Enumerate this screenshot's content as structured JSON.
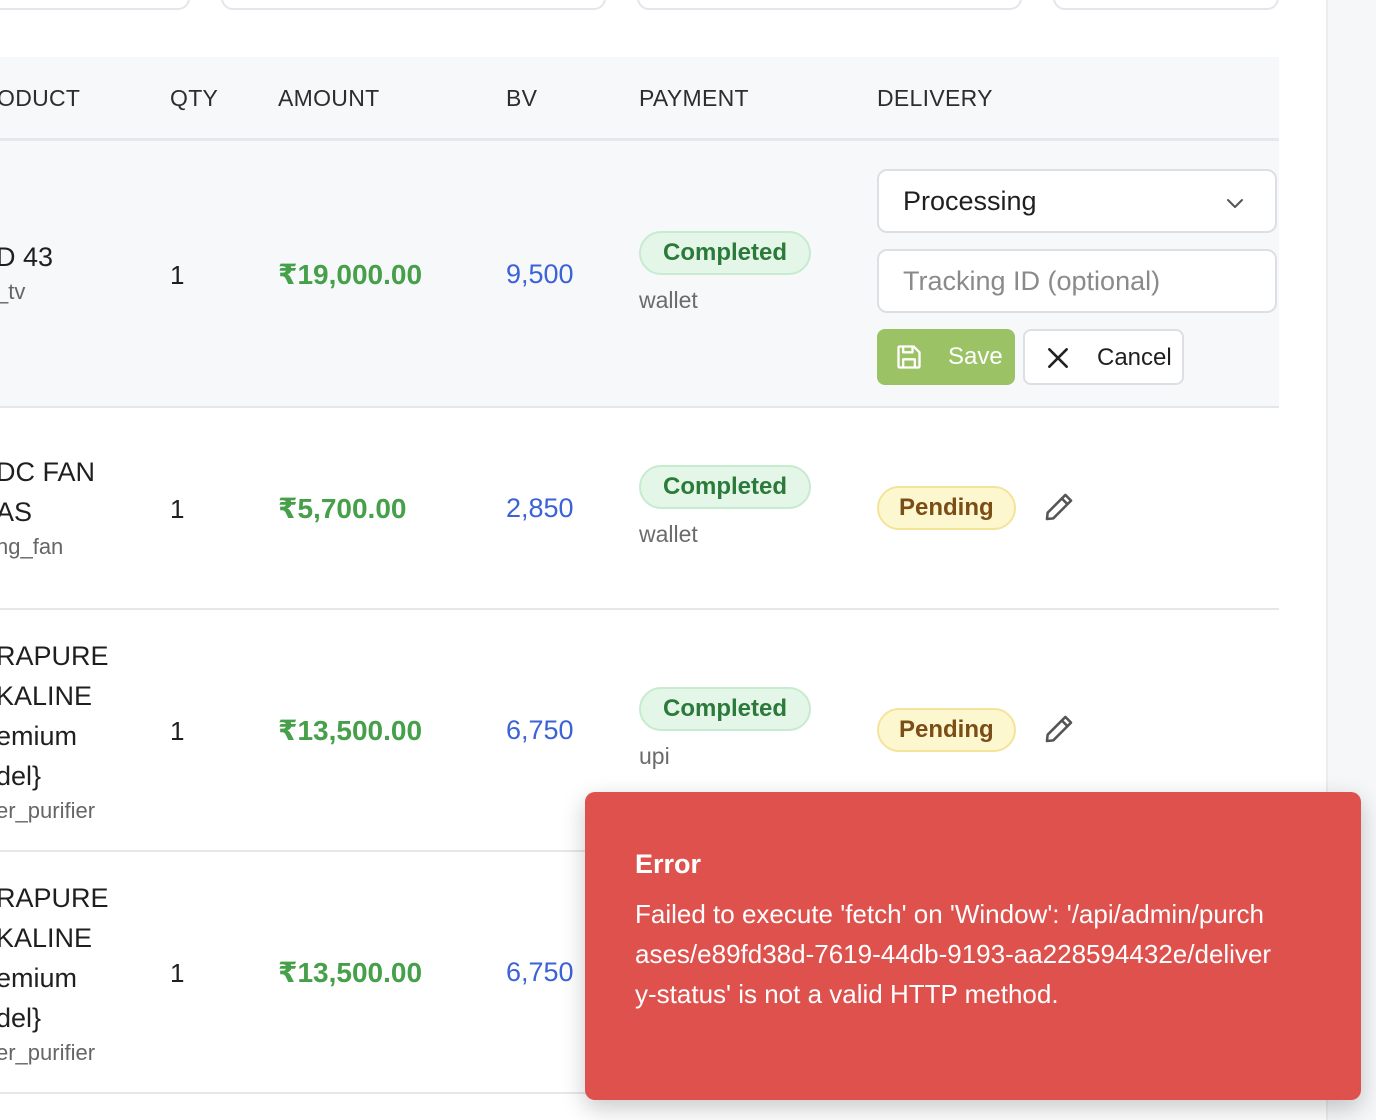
{
  "table": {
    "headers": {
      "product": "ODUCT",
      "qty": "QTY",
      "amount": "AMOUNT",
      "bv": "BV",
      "payment": "PAYMENT",
      "delivery": "DELIVERY"
    },
    "rows": [
      {
        "product_lines": [
          "D 43"
        ],
        "category": "_tv",
        "qty": "1",
        "amount": "₹19,000.00",
        "bv": "9,500",
        "payment_status": "Completed",
        "payment_method": "wallet",
        "editing": true,
        "delivery_select": "Processing",
        "tracking_placeholder": "Tracking ID (optional)",
        "save_label": "Save",
        "cancel_label": "Cancel"
      },
      {
        "product_lines": [
          "DC FAN",
          "AS"
        ],
        "category": "ng_fan",
        "qty": "1",
        "amount": "₹5,700.00",
        "bv": "2,850",
        "payment_status": "Completed",
        "payment_method": "wallet",
        "delivery_status": "Pending"
      },
      {
        "product_lines": [
          "RAPURE",
          "KALINE",
          "emium",
          "del}"
        ],
        "category": "er_purifier",
        "qty": "1",
        "amount": "₹13,500.00",
        "bv": "6,750",
        "payment_status": "Completed",
        "payment_method": "upi",
        "delivery_status": "Pending"
      },
      {
        "product_lines": [
          "RAPURE",
          "KALINE",
          "emium",
          "del}"
        ],
        "category": "er_purifier",
        "qty": "1",
        "amount": "₹13,500.00",
        "bv": "6,750"
      }
    ]
  },
  "toast": {
    "title": "Error",
    "message": "Failed to execute 'fetch' on 'Window': '/api/admin/purchases/e89fd38d-7619-44db-9193-aa228594432e/delivery-status' is not a valid HTTP method."
  },
  "icons": {
    "edit": "pencil-icon",
    "save": "floppy-disk-icon",
    "cancel": "close-icon",
    "select": "chevron-down-icon"
  },
  "colors": {
    "amount": "#46a049",
    "bv": "#3b62d6",
    "save_button": "#9bc265",
    "toast_bg": "#de514d",
    "completed_badge_bg": "#e4f6e8",
    "pending_badge_bg": "#fdf7cf"
  }
}
